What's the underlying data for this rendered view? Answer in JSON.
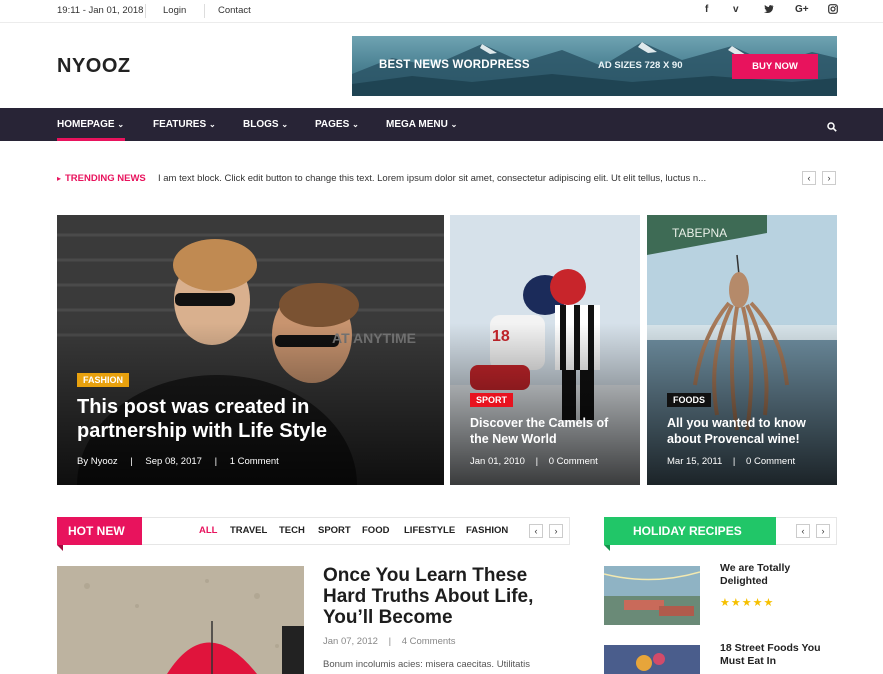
{
  "topbar": {
    "datetime": "19:11 - Jan 01, 2018",
    "login": "Login",
    "contact": "Contact",
    "social": [
      "f",
      "v",
      "t",
      "G+",
      "ig"
    ]
  },
  "header": {
    "logo": "NYOOZ",
    "banner": {
      "headline": "BEST NEWS WORDPRESS",
      "sizes": "AD SIZES 728 X 90",
      "cta": "BUY NOW"
    }
  },
  "nav": {
    "items": [
      "HOMEPAGE",
      "FEATURES",
      "BLOGS",
      "PAGES",
      "MEGA MENU"
    ],
    "active": "HOMEPAGE"
  },
  "trending": {
    "label": "TRENDING NEWS",
    "text": "I am text block. Click edit button to change this text. Lorem ipsum dolor sit amet, consectetur adipiscing elit. Ut elit tellus, luctus n..."
  },
  "hero": [
    {
      "category": "FASHION",
      "category_color": "#e8a10e",
      "title": "This post was created in partnership with Life Style",
      "author": "By Nyooz",
      "date": "Sep 08, 2017",
      "comments": "1 Comment"
    },
    {
      "category": "SPORT",
      "category_color": "#e8131f",
      "title": "Discover the Camels of the New World",
      "date": "Jan 01, 2010",
      "comments": "0 Comment"
    },
    {
      "category": "FOODS",
      "category_color": "#111111",
      "title": "All you wanted to know about Provencal wine!",
      "date": "Mar 15, 2011",
      "comments": "0 Comment"
    }
  ],
  "hot_new": {
    "title": "HOT NEW",
    "filters": [
      "ALL",
      "TRAVEL",
      "TECH",
      "SPORT",
      "FOOD",
      "LIFESTYLE",
      "FASHION"
    ],
    "active_filter": "ALL",
    "article": {
      "title": "Once You Learn These Hard Truths About Life, You’ll Become",
      "date": "Jan 07, 2012",
      "comments": "4 Comments",
      "excerpt": "Bonum incolumis acies: misera caecitas. Utilitatis"
    }
  },
  "holiday": {
    "title": "HOLIDAY RECIPES",
    "items": [
      {
        "title": "We are Totally Delighted",
        "rating": "★★★★★"
      },
      {
        "title": "18 Street Foods You Must Eat In"
      }
    ]
  },
  "colors": {
    "accent": "#e8135d",
    "nav_bg": "#282436",
    "green": "#21c668"
  }
}
